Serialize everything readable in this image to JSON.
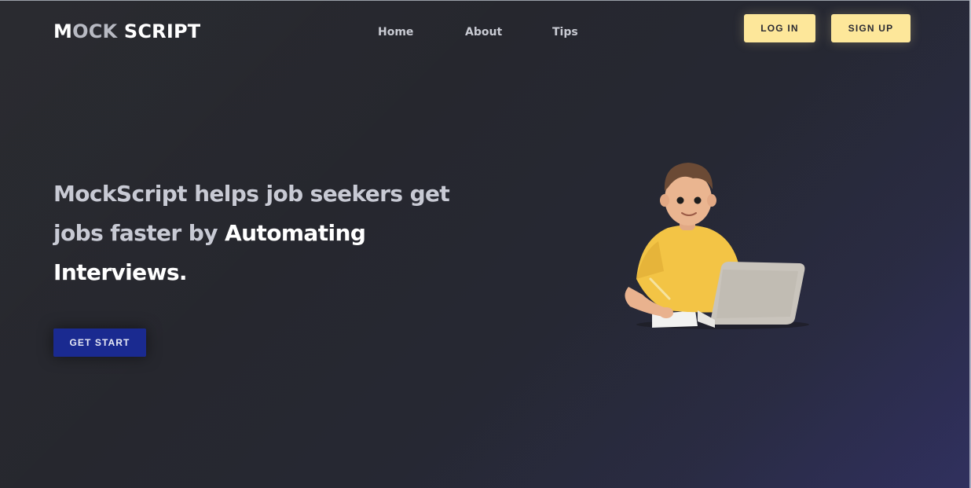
{
  "brand": {
    "logo_m": "M",
    "logo_ock": "OCK",
    "logo_script": " SCRIPT"
  },
  "nav": {
    "home": "Home",
    "about": "About",
    "tips": "Tips"
  },
  "auth": {
    "login": "LOG IN",
    "signup": "SIGN UP"
  },
  "hero": {
    "line1": "MockScript helps job seekers get",
    "line2_muted": "jobs faster by ",
    "line2_bright": "Automating",
    "line3": "Interviews.",
    "cta": "GET START"
  },
  "colors": {
    "accent_yellow": "#fde79a",
    "cta_blue": "#1a2a90",
    "background": "#26272e"
  }
}
